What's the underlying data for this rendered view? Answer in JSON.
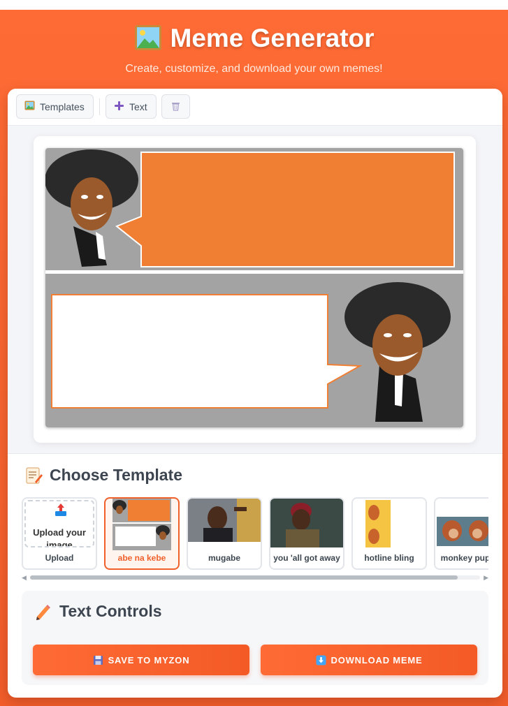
{
  "header": {
    "title": "Meme Generator",
    "subtitle": "Create, customize, and download your own memes!",
    "title_icon": "picture-frame-icon"
  },
  "toolbar": {
    "templates_label": "Templates",
    "templates_icon": "picture-icon",
    "text_label": "Text",
    "text_icon": "plus-icon",
    "delete_icon": "trash-icon"
  },
  "canvas": {
    "template": "abe na kebe",
    "top_bubble_color": "#f07f34",
    "bottom_bubble_color": "#ffffff",
    "background_color": "#a3a3a3"
  },
  "templates_section": {
    "title": "Choose Template",
    "title_icon": "memo-icon",
    "upload_text": "Upload your image",
    "upload_icon": "upload-tray-icon",
    "items": [
      {
        "label": "Upload",
        "selected": false
      },
      {
        "label": "abe na kebe",
        "selected": true
      },
      {
        "label": "mugabe",
        "selected": false
      },
      {
        "label": "you 'all got away",
        "selected": false
      },
      {
        "label": "hotline bling",
        "selected": false
      },
      {
        "label": "monkey puppet",
        "selected": false
      }
    ]
  },
  "text_controls": {
    "title": "Text Controls",
    "title_icon": "pencil-icon",
    "save_label": "SAVE TO MYZON",
    "save_icon": "floppy-disk-icon",
    "download_label": "DOWNLOAD MEME",
    "download_icon": "down-arrow-icon"
  },
  "colors": {
    "accent": "#ff6b35",
    "selected_border": "#f0602b"
  }
}
